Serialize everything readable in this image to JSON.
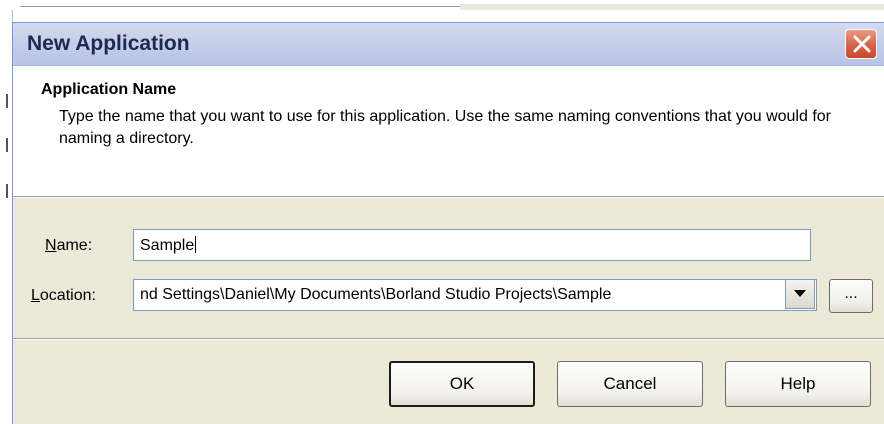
{
  "window": {
    "title": "New Application"
  },
  "header": {
    "title": "Application Name",
    "description": "Type the name that you want to use for this application.  Use the same naming conventions that you would for naming a directory."
  },
  "form": {
    "name_label": "Name:",
    "name_label_accel": "N",
    "name_label_rest": "ame:",
    "name_value": "Sample",
    "location_label_accel": "L",
    "location_label_rest": "ocation:",
    "location_value": "nd Settings\\Daniel\\My Documents\\Borland Studio Projects\\Sample",
    "browse_label": "..."
  },
  "buttons": {
    "ok": "OK",
    "cancel": "Cancel",
    "help": "Help"
  },
  "colors": {
    "dialog_bg": "#ece9d8",
    "titlebar": "#c7d0ea",
    "close_red": "#d9664a"
  },
  "icons": [
    "close-icon",
    "dropdown-arrow-icon"
  ]
}
